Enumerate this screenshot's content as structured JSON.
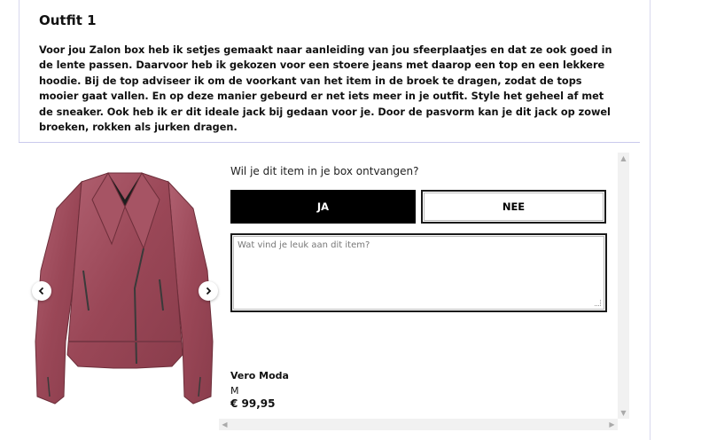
{
  "outfit": {
    "title": "Outfit 1",
    "description": "Voor jou Zalon box heb ik setjes gemaakt naar aanleiding van jou sfeerplaatjes en dat ze ook goed in de lente passen. Daarvoor heb ik gekozen voor een stoere jeans met daarop een top en een lekkere hoodie. Bij de top adviseer ik om de voorkant van het item in de broek te dragen, zodat de tops mooier gaat vallen. En op deze manier gebeurd er net iets meer in je outfit. Style het geheel af met de sneaker. Ook heb ik er dit ideale jack bij gedaan voor je. Door de pasvorm kan je dit jack op zowel broeken, rokken als jurken dragen."
  },
  "item": {
    "question": "Wil je dit item in je box ontvangen?",
    "yes_label": "JA",
    "no_label": "NEE",
    "comment_placeholder": "Wat vind je leuk aan dit item?",
    "brand": "Vero Moda",
    "size": "M",
    "price": "€ 99,95",
    "image_icon": "suede-biker-jacket",
    "image_color": "#9e4c5a"
  },
  "carousel": {
    "prev_icon": "chevron-left-icon",
    "next_icon": "chevron-right-icon"
  }
}
